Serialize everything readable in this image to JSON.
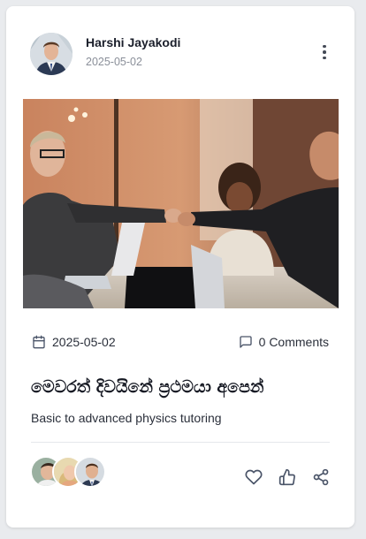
{
  "author": {
    "name": "Harshi Jayakodi",
    "date": "2025-05-02",
    "avatar_icon": "user-avatar"
  },
  "post": {
    "date": "2025-05-02",
    "comments": "0 Comments",
    "title": "මෙවරත් දිවයිනේ ප්‍රථමයා අපෙන්",
    "description": "Basic to advanced physics tutoring"
  },
  "participants": [
    "participant-avatar-1",
    "participant-avatar-2",
    "participant-avatar-3"
  ],
  "icons": {
    "calendar": "calendar-icon",
    "comment": "comment-icon",
    "like": "heart-icon",
    "thumbs": "thumbs-up-icon",
    "share": "share-icon",
    "menu": "more-vertical-icon"
  },
  "colors": {
    "background": "#e9ebee",
    "card": "#ffffff",
    "text": "#1f2330",
    "muted": "#8a8f99",
    "icon": "#4a5468"
  }
}
